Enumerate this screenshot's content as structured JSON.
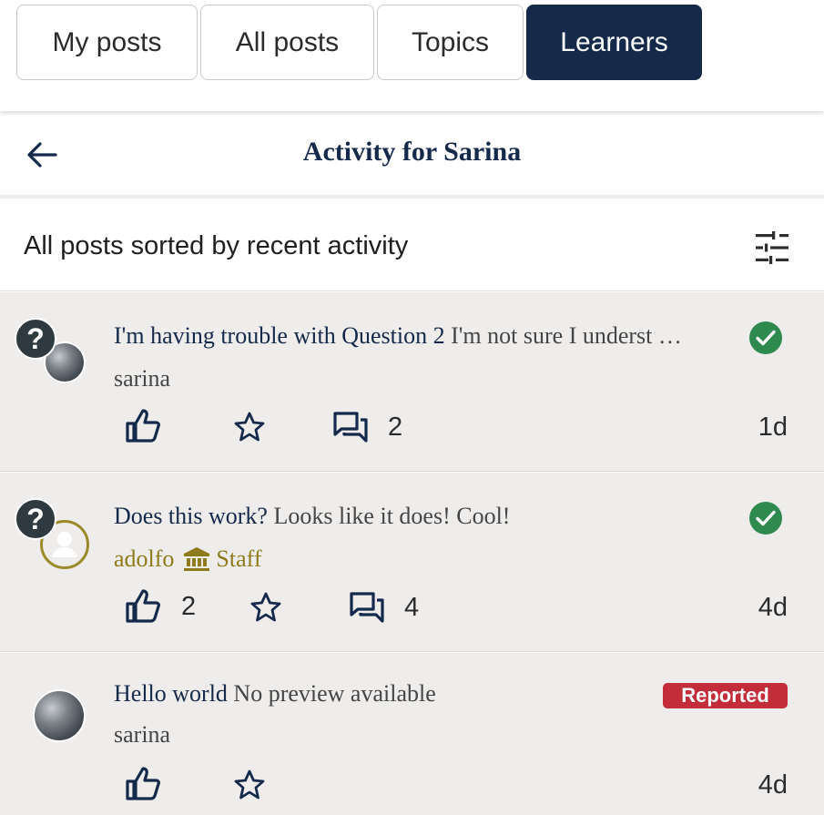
{
  "tabs": [
    {
      "label": "My posts",
      "active": false
    },
    {
      "label": "All posts",
      "active": false
    },
    {
      "label": "Topics",
      "active": false
    },
    {
      "label": "Learners",
      "active": true
    }
  ],
  "header": {
    "title": "Activity for Sarina",
    "back_icon": "arrow-left-icon"
  },
  "filter": {
    "label": "All posts sorted by recent activity",
    "icon": "filter-sliders-icon"
  },
  "colors": {
    "brand": "#15294b",
    "post_bg": "#efedeb",
    "success": "#2f8a4f",
    "reported": "#c32d3a",
    "staff": "#8e7b1c"
  },
  "posts": [
    {
      "title_head": "I'm having trouble with Question 2",
      "title_body": " I'm not sure I underst …",
      "author": "sarina",
      "answered": true,
      "like_count": "",
      "comment_count": "2",
      "age": "1d"
    },
    {
      "title_head": "Does this work?",
      "title_body": " Looks like it does! Cool!",
      "author": "adolfo",
      "role": "Staff",
      "answered": true,
      "like_count": "2",
      "comment_count": "4",
      "age": "4d"
    },
    {
      "title_head": "Hello world",
      "title_body": " No preview available",
      "author": "sarina",
      "badge": "Reported",
      "like_count": "",
      "age": "4d"
    }
  ]
}
